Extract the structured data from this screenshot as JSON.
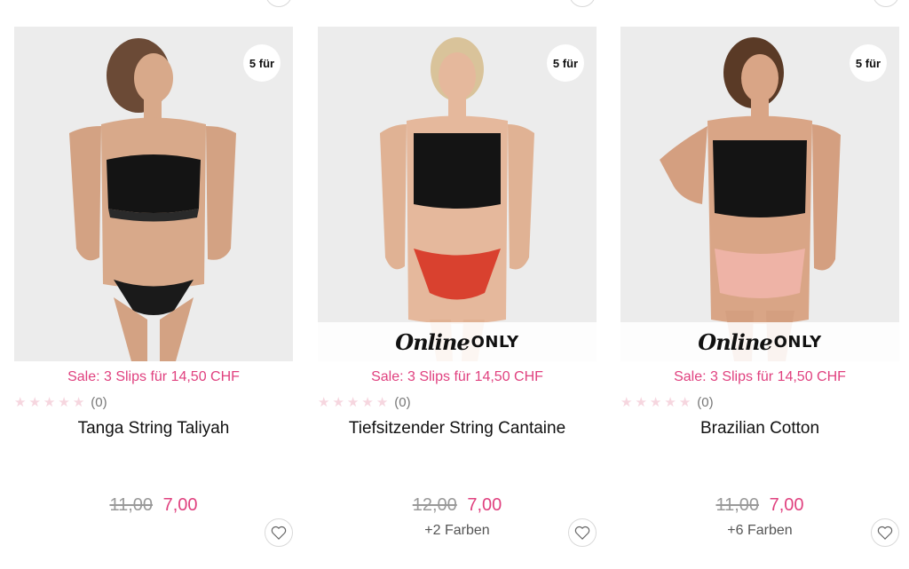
{
  "products": [
    {
      "badge": "5 für",
      "online_only": false,
      "sale_text": "Sale: 3 Slips für 14,50 CHF",
      "rating_count": "(0)",
      "title": "Tanga String Taliyah",
      "old_price": "11,00",
      "new_price": "7,00",
      "colors": "",
      "bottom_color": "#1a1a1a"
    },
    {
      "badge": "5 für",
      "online_only": true,
      "online_script": "Online",
      "online_only_label": "ONLY",
      "sale_text": "Sale: 3 Slips für 14,50 CHF",
      "rating_count": "(0)",
      "title": "Tiefsitzender String Cantaine",
      "old_price": "12,00",
      "new_price": "7,00",
      "colors": "+2 Farben",
      "bottom_color": "#d9412f"
    },
    {
      "badge": "5 für",
      "online_only": true,
      "online_script": "Online",
      "online_only_label": "ONLY",
      "sale_text": "Sale: 3 Slips für 14,50 CHF",
      "rating_count": "(0)",
      "title": "Brazilian Cotton",
      "old_price": "11,00",
      "new_price": "7,00",
      "colors": "+6 Farben",
      "bottom_color": "#eeb3a6"
    }
  ],
  "colors": {
    "accent": "#e0417f",
    "star_empty": "#f6d6df",
    "top_black": "#141414",
    "image_bg": "#ececec"
  },
  "icons": {
    "star": "star-icon",
    "heart": "heart-icon"
  }
}
